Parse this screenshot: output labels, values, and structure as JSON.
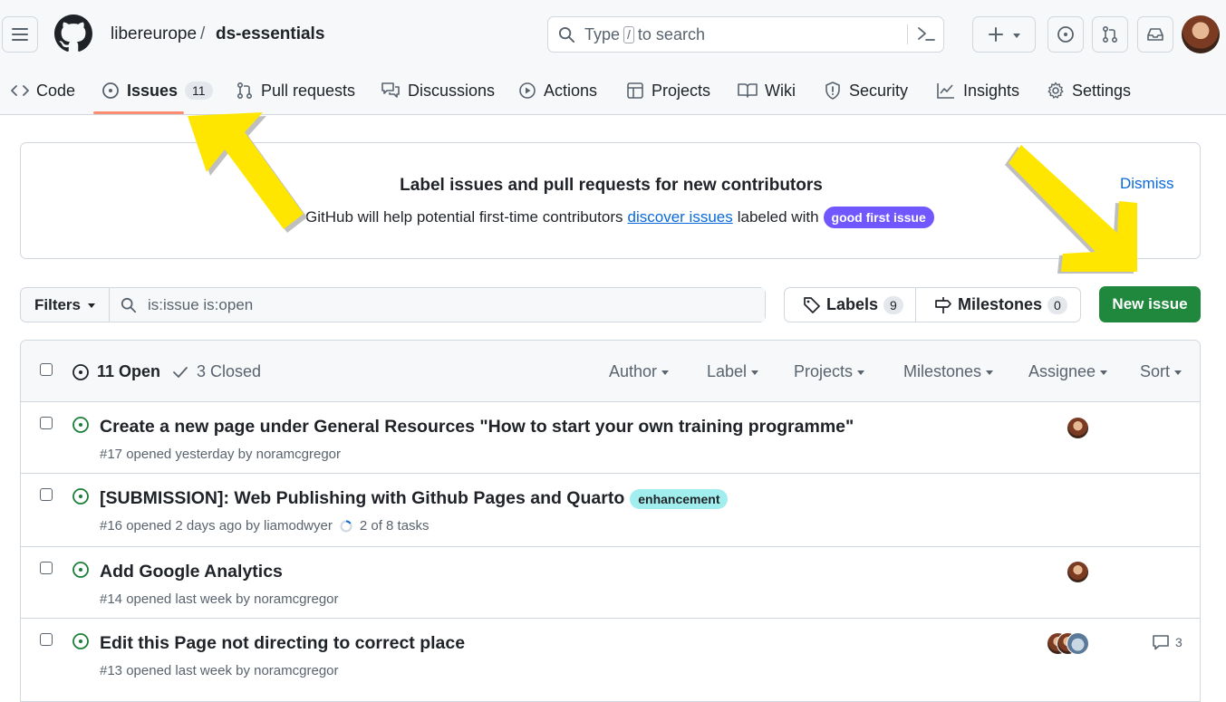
{
  "header": {
    "owner": "libereurope",
    "separator": "/",
    "repo": "ds-essentials",
    "search_placeholder_pre": "Type",
    "search_key": "/",
    "search_placeholder_post": "to search"
  },
  "tabs": [
    {
      "label": "Code",
      "icon": "code-icon"
    },
    {
      "label": "Issues",
      "count": "11",
      "icon": "issue-opened-icon"
    },
    {
      "label": "Pull requests",
      "icon": "git-pull-request-icon"
    },
    {
      "label": "Discussions",
      "icon": "comment-discussion-icon"
    },
    {
      "label": "Actions",
      "icon": "play-icon"
    },
    {
      "label": "Projects",
      "icon": "table-icon"
    },
    {
      "label": "Wiki",
      "icon": "book-icon"
    },
    {
      "label": "Security",
      "icon": "shield-icon"
    },
    {
      "label": "Insights",
      "icon": "graph-icon"
    },
    {
      "label": "Settings",
      "icon": "gear-icon"
    }
  ],
  "banner": {
    "title": "Label issues and pull requests for new contributors",
    "text_pre": "GitHub will help potential first-time contributors",
    "link": "discover issues",
    "text_post": "labeled with",
    "label": "good first issue",
    "dismiss": "Dismiss"
  },
  "toolbar": {
    "filters": "Filters",
    "filter_value": "is:issue is:open",
    "labels": "Labels",
    "labels_count": "9",
    "milestones": "Milestones",
    "milestones_count": "0",
    "new_issue": "New issue"
  },
  "list_header": {
    "open": "11 Open",
    "closed": "3 Closed",
    "author": "Author",
    "label": "Label",
    "projects": "Projects",
    "milestones": "Milestones",
    "assignee": "Assignee",
    "sort": "Sort"
  },
  "issues": [
    {
      "title": "Create a new page under General Resources \"How to start your own training programme\"",
      "meta": "#17 opened yesterday by noramcgregor"
    },
    {
      "title": "[SUBMISSION]: Web Publishing with Github Pages and Quarto",
      "label": "enhancement",
      "meta": "#16 opened 2 days ago by liamodwyer",
      "tasks": "2 of 8 tasks"
    },
    {
      "title": "Add Google Analytics",
      "meta": "#14 opened last week by noramcgregor"
    },
    {
      "title": "Edit this Page not directing to correct place",
      "meta": "#13 opened last week by noramcgregor",
      "comments": "3"
    }
  ],
  "colors": {
    "green": "#1f883d",
    "accent": "#0969da",
    "highlight_arrow": "#ffe600",
    "tab_underline": "#fd8c73",
    "good_first_issue": "#7057ff",
    "enhancement": "#a2eeef"
  }
}
